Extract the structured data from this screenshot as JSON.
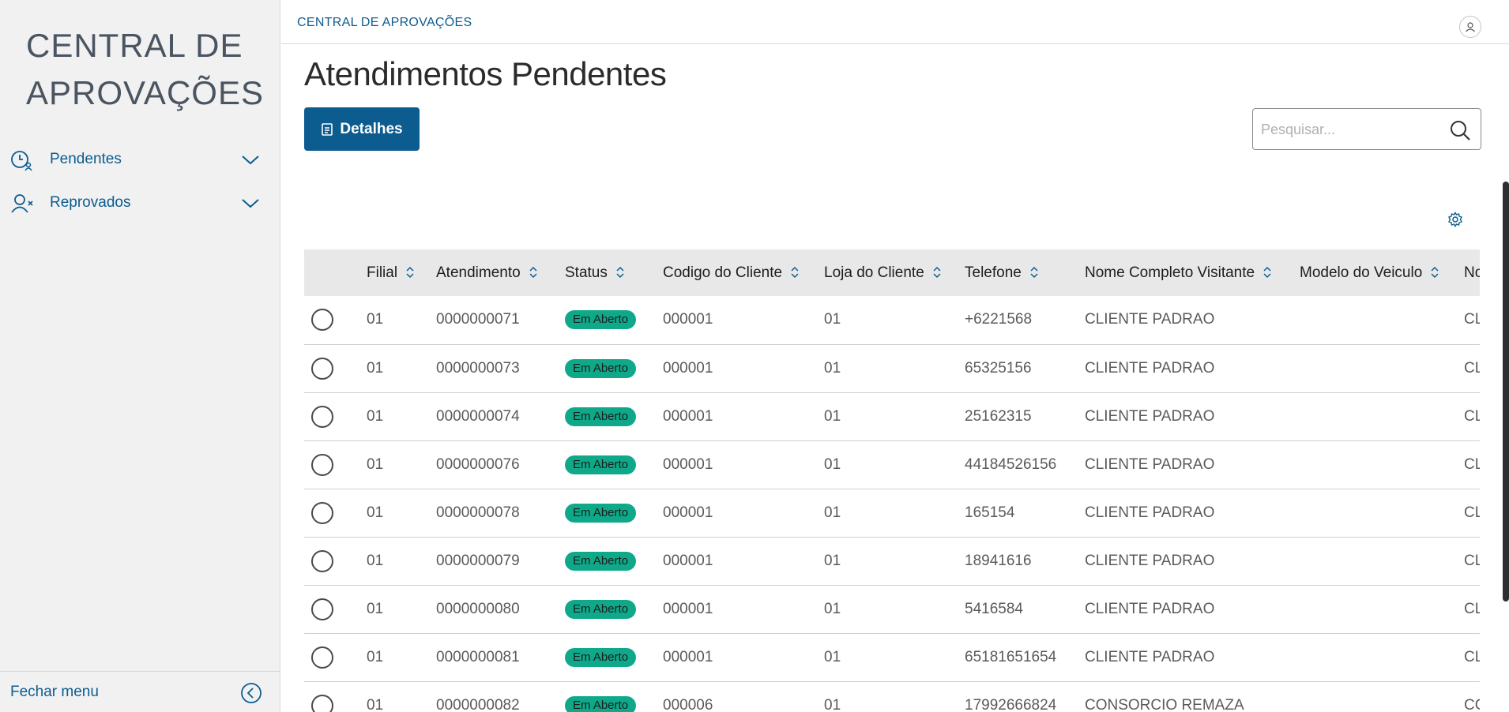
{
  "sidebar": {
    "brand": "CENTRAL DE APROVAÇÕES",
    "items": [
      {
        "label": "Pendentes",
        "icon": "clock-user-icon"
      },
      {
        "label": "Reprovados",
        "icon": "user-x-icon"
      }
    ],
    "footer_label": "Fechar menu"
  },
  "topbar": {
    "breadcrumb": "CENTRAL DE APROVAÇÕES"
  },
  "page": {
    "title": "Atendimentos Pendentes",
    "details_button": "Detalhes",
    "search_placeholder": "Pesquisar..."
  },
  "table": {
    "columns": [
      "Filial",
      "Atendimento",
      "Status",
      "Codigo do Cliente",
      "Loja do Cliente",
      "Telefone",
      "Nome Completo Visitante",
      "Modelo do Veiculo",
      "No"
    ],
    "rows": [
      {
        "filial": "01",
        "atendimento": "0000000071",
        "status": "Em Aberto",
        "codigo": "000001",
        "loja": "01",
        "telefone": "+6221568",
        "nome": "CLIENTE PADRAO",
        "modelo": "",
        "extra": "CL"
      },
      {
        "filial": "01",
        "atendimento": "0000000073",
        "status": "Em Aberto",
        "codigo": "000001",
        "loja": "01",
        "telefone": "65325156",
        "nome": "CLIENTE PADRAO",
        "modelo": "",
        "extra": "CL"
      },
      {
        "filial": "01",
        "atendimento": "0000000074",
        "status": "Em Aberto",
        "codigo": "000001",
        "loja": "01",
        "telefone": "25162315",
        "nome": "CLIENTE PADRAO",
        "modelo": "",
        "extra": "CL"
      },
      {
        "filial": "01",
        "atendimento": "0000000076",
        "status": "Em Aberto",
        "codigo": "000001",
        "loja": "01",
        "telefone": "44184526156",
        "nome": "CLIENTE PADRAO",
        "modelo": "",
        "extra": "CL"
      },
      {
        "filial": "01",
        "atendimento": "0000000078",
        "status": "Em Aberto",
        "codigo": "000001",
        "loja": "01",
        "telefone": "165154",
        "nome": "CLIENTE PADRAO",
        "modelo": "",
        "extra": "CL"
      },
      {
        "filial": "01",
        "atendimento": "0000000079",
        "status": "Em Aberto",
        "codigo": "000001",
        "loja": "01",
        "telefone": "18941616",
        "nome": "CLIENTE PADRAO",
        "modelo": "",
        "extra": "CL"
      },
      {
        "filial": "01",
        "atendimento": "0000000080",
        "status": "Em Aberto",
        "codigo": "000001",
        "loja": "01",
        "telefone": "5416584",
        "nome": "CLIENTE PADRAO",
        "modelo": "",
        "extra": "CL"
      },
      {
        "filial": "01",
        "atendimento": "0000000081",
        "status": "Em Aberto",
        "codigo": "000001",
        "loja": "01",
        "telefone": "65181651654",
        "nome": "CLIENTE PADRAO",
        "modelo": "",
        "extra": "CL"
      },
      {
        "filial": "01",
        "atendimento": "0000000082",
        "status": "Em Aberto",
        "codigo": "000006",
        "loja": "01",
        "telefone": "17992666824",
        "nome": "CONSORCIO REMAZA",
        "modelo": "",
        "extra": "CC"
      }
    ]
  },
  "colors": {
    "accent": "#0c5c8f",
    "badge": "#0fa98a"
  }
}
